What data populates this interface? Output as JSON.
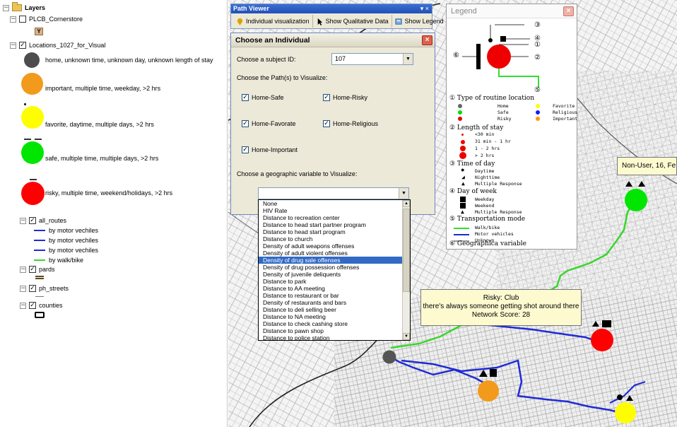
{
  "toc": {
    "layers_label": "Layers",
    "cornerstore_label": "PLCB_Cornerstore",
    "locations_label": "Locations_1027_for_Visual",
    "locations_legend": [
      {
        "label": "home, unknown time, unknown day, unknown length of stay",
        "color": "#4d4d4d"
      },
      {
        "label": "important, multiple time, weekday, >2 hrs",
        "color": "#f29a1b"
      },
      {
        "label": "favorite, daytime, multiple days, >2 hrs",
        "color": "#fefe00"
      },
      {
        "label": "safe, multiple time, multiple days, >2 hrs",
        "color": "#00e600"
      },
      {
        "label": "risky, multiple time, weekend/holidays, >2 hrs",
        "color": "#ff0000"
      }
    ],
    "routes_label": "all_routes",
    "routes": [
      {
        "label": "by motor vechiles",
        "color": "#1f2bd6"
      },
      {
        "label": "by motor vechiles",
        "color": "#1f2bd6"
      },
      {
        "label": "by motor vechiles",
        "color": "#1f2bd6"
      },
      {
        "label": "by walk/bike",
        "color": "#3ad62c"
      }
    ],
    "pards_label": "pards",
    "streets_label": "ph_streets",
    "counties_label": "counties"
  },
  "path_viewer": {
    "title": "Path Viewer",
    "controls": "▾ ×",
    "buttons": [
      "Individual visualization",
      "Show Qualitative Data",
      "Show Legend"
    ]
  },
  "dialog": {
    "title": "Choose an Individual",
    "subject_label": "Choose a subject ID:",
    "subject_value": "107",
    "paths_label": "Choose the Path(s) to Visualize:",
    "paths": [
      {
        "label": "Home-Safe",
        "checked": true
      },
      {
        "label": "Home-Risky",
        "checked": true
      },
      {
        "label": "Home-Favorate",
        "checked": true
      },
      {
        "label": "Home-Religious",
        "checked": true
      },
      {
        "label": "Home-Important",
        "checked": true
      }
    ],
    "geo_label": "Choose a geographic variable to Visualize:",
    "geo_value": "",
    "options": [
      "None",
      "HIV Rate",
      "Distance to recreation center",
      "Distance to head start partner program",
      "Distance to head start program",
      "Distance to church",
      "Density of adult weapons offenses",
      "Density of adult violent offenses",
      "Density of drug sale offenses",
      "Density of drug possession offenses",
      "Density of juvenile deliquents",
      "Distance to park",
      "Distance to AA meeting",
      "Distance to restaurant or bar",
      "Density of restaurants and bars",
      "Distance to deli selling beer",
      "Distance to NA meeting",
      "Distance to check cashing store",
      "Distance to pawn shop",
      "Distance to police station"
    ],
    "selected_option": "Density of drug sale offenses"
  },
  "legend": {
    "title": "Legend",
    "diagram_numbers": [
      "③",
      "④",
      "①",
      "②",
      "⑥",
      "⑤"
    ],
    "sections": [
      "① Type of routine location",
      "② Length of stay",
      "③ Time of day",
      "④ Day of week",
      "⑤ Transportation mode",
      "⑥ Geographica variable"
    ],
    "location_types": [
      {
        "label": "Home",
        "color": "#666666"
      },
      {
        "label": "Favorite",
        "color": "#ffff00"
      },
      {
        "label": "Safe",
        "color": "#00dd00"
      },
      {
        "label": "Religious",
        "color": "#1a1aee"
      },
      {
        "label": "Risky",
        "color": "#ee0000"
      },
      {
        "label": "Important",
        "color": "#ff9900"
      }
    ],
    "stay_lengths": [
      "<30 min",
      "31 min - 1 hr",
      "1 - 2 hrs",
      "> 2 hrs"
    ],
    "times_of_day": [
      "Daytime",
      "Nighttime",
      "Multiple Response"
    ],
    "days_of_week": [
      "Weekday",
      "Weekend",
      "Multiple Response"
    ],
    "transport_modes": [
      {
        "label": "Walk/bike",
        "color": "#33dd33"
      },
      {
        "label": "Motor vehicles",
        "color": "#1a2ccc"
      },
      {
        "label": "Unknown",
        "color": "#999999"
      }
    ]
  },
  "tooltips": {
    "risky": [
      "Risky: Club",
      "there's always someone getting shot around there",
      "Network Score: 28"
    ],
    "nonuser": "Non-User, 16, Fe"
  }
}
